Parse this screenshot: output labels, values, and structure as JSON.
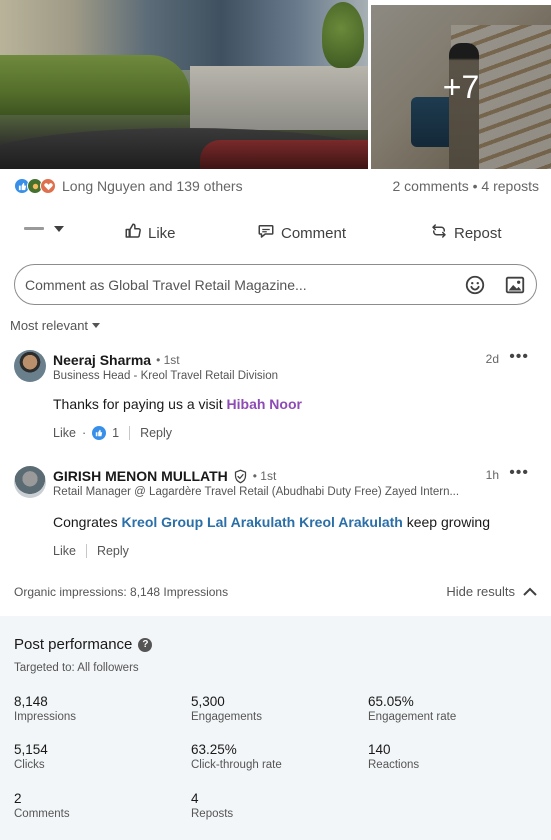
{
  "photos": {
    "more_count": "+7"
  },
  "social": {
    "reactions_text": "Long Nguyen and 139 others",
    "comments_reposts": "2 comments • 4 reposts"
  },
  "actions": {
    "like": "Like",
    "comment": "Comment",
    "repost": "Repost"
  },
  "comment_box": {
    "placeholder": "Comment as Global Travel Retail Magazine..."
  },
  "sort": {
    "label": "Most relevant"
  },
  "comments": [
    {
      "name": "Neeraj Sharma",
      "degree": "• 1st",
      "headline": "Business Head - Kreol Travel Retail Division",
      "time": "2d",
      "more": "•••",
      "text": "Thanks for paying us a visit ",
      "mention": "Hibah Noor",
      "like_label": "Like",
      "like_sep": "·",
      "like_count": "1",
      "reply_label": "Reply"
    },
    {
      "name": "GIRISH MENON MULLATH",
      "degree": "• 1st",
      "headline": "Retail Manager @ Lagardère Travel Retail (Abudhabi Duty Free) Zayed Intern...",
      "time": "1h",
      "more": "•••",
      "text_before": "Congrates ",
      "mention": "Kreol Group Lal Arakulath Kreol Arakulath",
      "text_after": " keep growing",
      "like_label": "Like",
      "reply_label": "Reply"
    }
  ],
  "impressions": {
    "text": "Organic impressions: 8,148 Impressions",
    "hide_label": "Hide results"
  },
  "performance": {
    "title": "Post performance",
    "targeted": "Targeted to: All followers",
    "metrics": [
      {
        "value": "8,148",
        "label": "Impressions"
      },
      {
        "value": "5,300",
        "label": "Engagements"
      },
      {
        "value": "65.05%",
        "label": "Engagement rate"
      },
      {
        "value": "5,154",
        "label": "Clicks"
      },
      {
        "value": "63.25%",
        "label": "Click-through rate"
      },
      {
        "value": "140",
        "label": "Reactions"
      },
      {
        "value": "2",
        "label": "Comments"
      },
      {
        "value": "4",
        "label": "Reposts"
      }
    ]
  }
}
